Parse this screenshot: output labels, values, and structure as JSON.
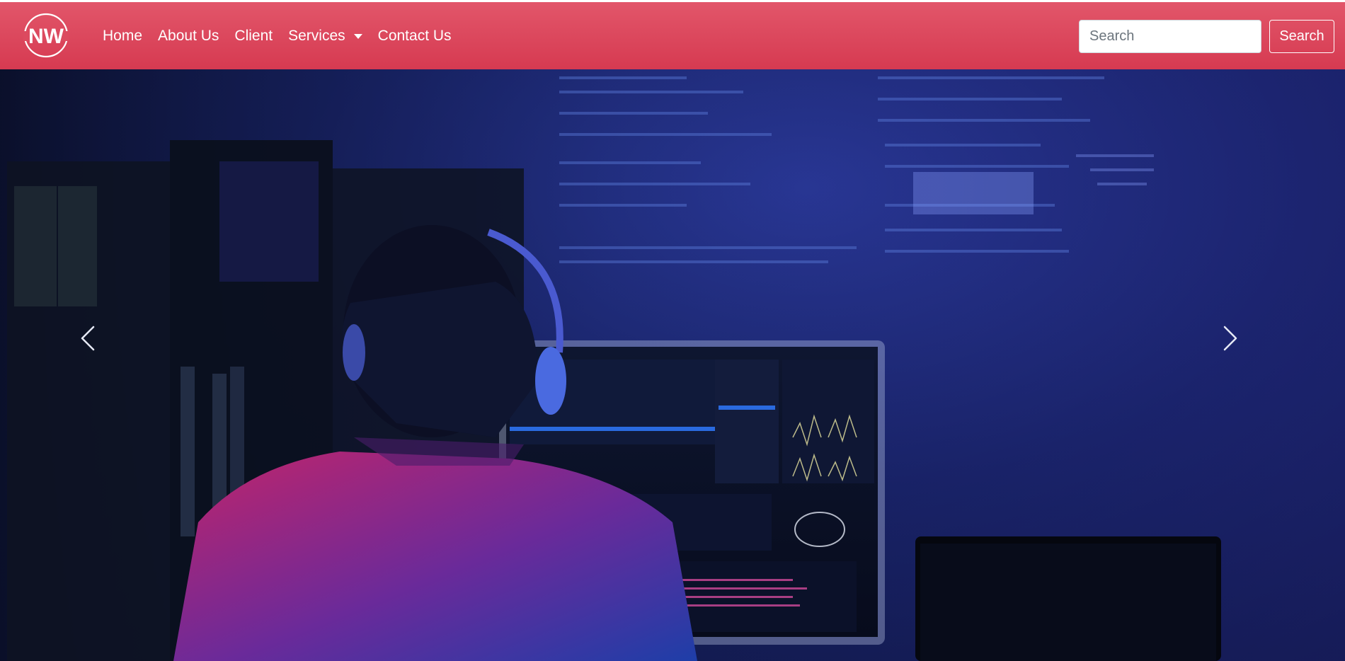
{
  "brand": {
    "logo_text": "NW"
  },
  "nav": {
    "items": [
      {
        "label": "Home"
      },
      {
        "label": "About Us"
      },
      {
        "label": "Client"
      },
      {
        "label": "Services"
      },
      {
        "label": "Contact Us"
      }
    ]
  },
  "search": {
    "placeholder": "Search",
    "button_label": "Search"
  },
  "carousel": {
    "prev_icon": "chevron-left-icon",
    "next_icon": "chevron-right-icon"
  },
  "colors": {
    "navbar": "#dc4a5f",
    "hero_blue": "#16205e"
  }
}
